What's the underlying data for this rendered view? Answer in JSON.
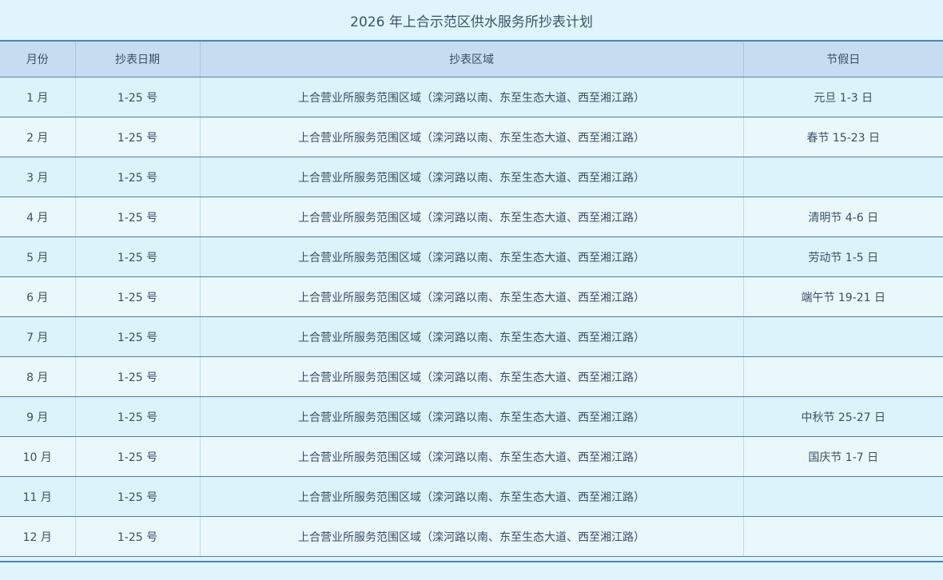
{
  "title": "2026 年上合示范区供水服务所抄表计划",
  "headers": {
    "month": "月份",
    "date": "抄表日期",
    "area": "抄表区域",
    "holiday": "节假日"
  },
  "rows": [
    {
      "month": "1 月",
      "date": "1-25 号",
      "area": "上合营业所服务范围区域（滦河路以南、东至生态大道、西至湘江路）",
      "holiday": "元旦 1-3 日"
    },
    {
      "month": "2 月",
      "date": "1-25 号",
      "area": "上合营业所服务范围区域（滦河路以南、东至生态大道、西至湘江路）",
      "holiday": "春节 15-23 日"
    },
    {
      "month": "3 月",
      "date": "1-25 号",
      "area": "上合营业所服务范围区域（滦河路以南、东至生态大道、西至湘江路）",
      "holiday": ""
    },
    {
      "month": "4 月",
      "date": "1-25 号",
      "area": "上合营业所服务范围区域（滦河路以南、东至生态大道、西至湘江路）",
      "holiday": "清明节 4-6 日"
    },
    {
      "month": "5 月",
      "date": "1-25 号",
      "area": "上合营业所服务范围区域（滦河路以南、东至生态大道、西至湘江路）",
      "holiday": "劳动节 1-5 日"
    },
    {
      "month": "6 月",
      "date": "1-25 号",
      "area": "上合营业所服务范围区域（滦河路以南、东至生态大道、西至湘江路）",
      "holiday": "端午节 19-21 日"
    },
    {
      "month": "7 月",
      "date": "1-25 号",
      "area": "上合营业所服务范围区域（滦河路以南、东至生态大道、西至湘江路）",
      "holiday": ""
    },
    {
      "month": "8 月",
      "date": "1-25 号",
      "area": "上合营业所服务范围区域（滦河路以南、东至生态大道、西至湘江路）",
      "holiday": ""
    },
    {
      "month": "9 月",
      "date": "1-25 号",
      "area": "上合营业所服务范围区域（滦河路以南、东至生态大道、西至湘江路）",
      "holiday": "中秋节 25-27 日"
    },
    {
      "month": "10 月",
      "date": "1-25 号",
      "area": "上合营业所服务范围区域（滦河路以南、东至生态大道、西至湘江路）",
      "holiday": "国庆节 1-7 日"
    },
    {
      "month": "11 月",
      "date": "1-25 号",
      "area": "上合营业所服务范围区域（滦河路以南、东至生态大道、西至湘江路）",
      "holiday": ""
    },
    {
      "month": "12 月",
      "date": "1-25 号",
      "area": "上合营业所服务范围区域（滦河路以南、东至生态大道、西至湘江路）",
      "holiday": ""
    }
  ]
}
